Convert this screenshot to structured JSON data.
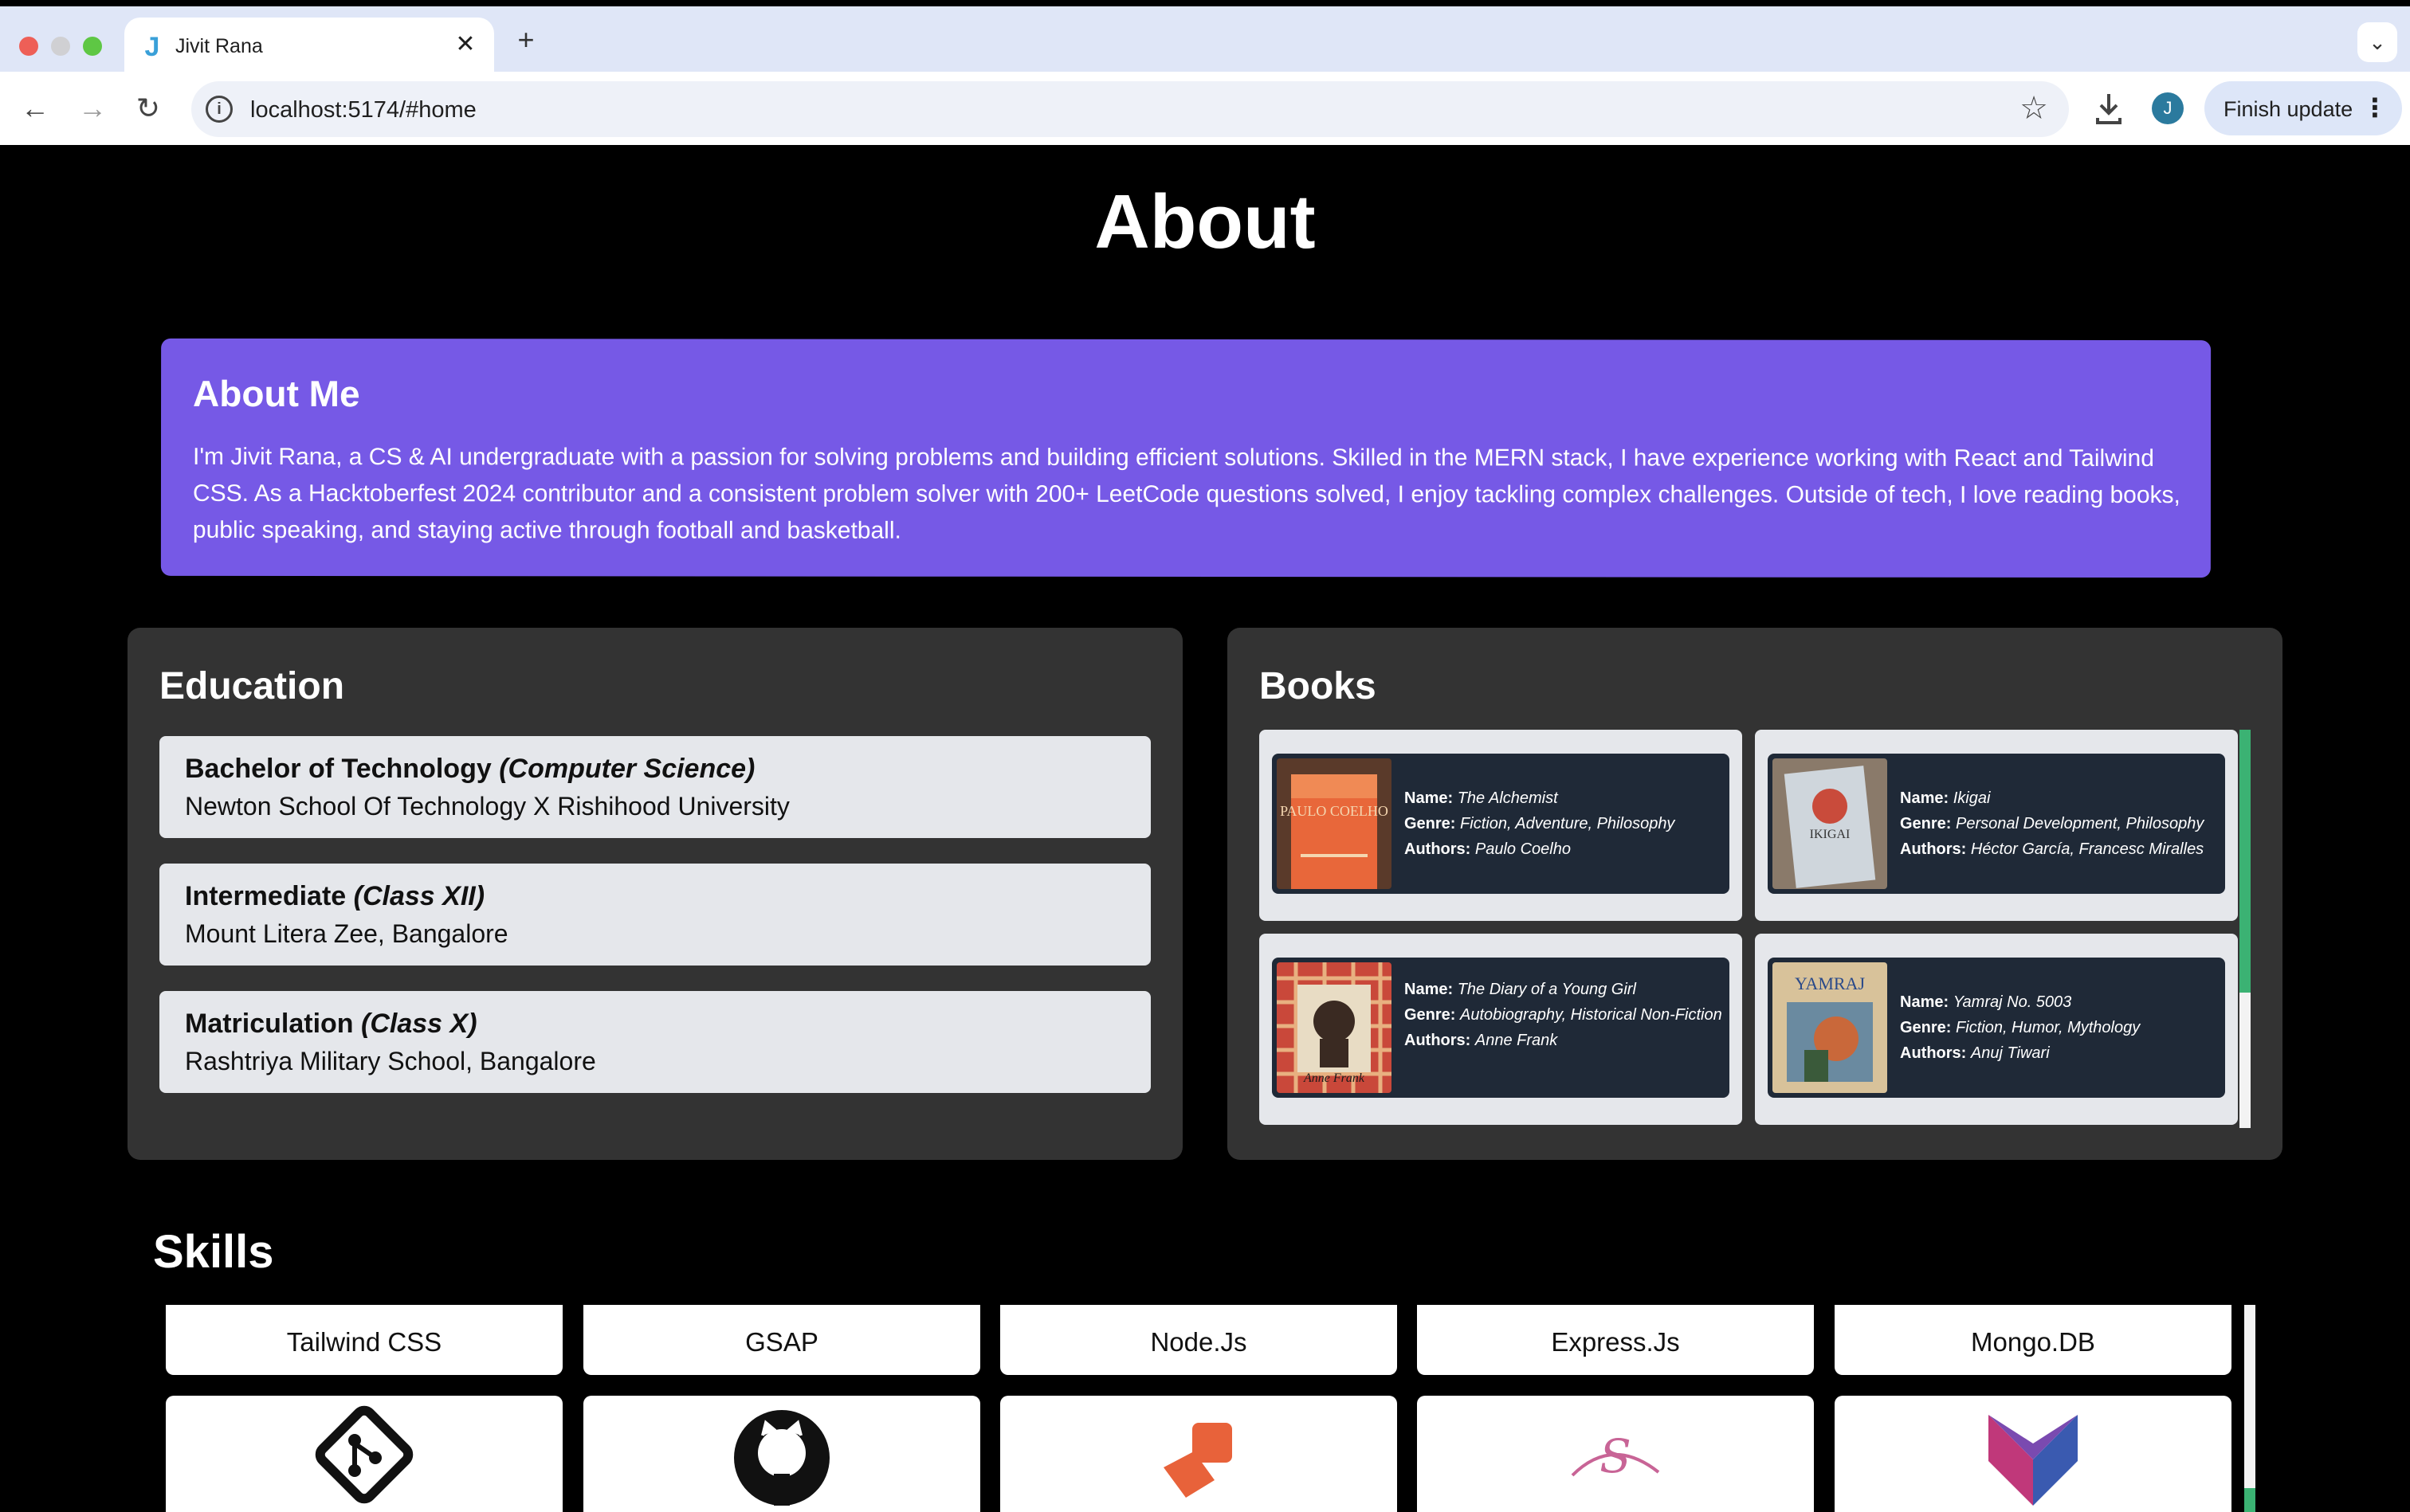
{
  "browser": {
    "tab_title": "Jivit Rana",
    "tab_favicon": "J",
    "url": "localhost:5174/#home",
    "profile_initial": "J",
    "finish_update_label": "Finish update"
  },
  "page": {
    "title": "About",
    "about": {
      "heading": "About Me",
      "text": "I'm Jivit Rana, a CS & AI undergraduate with a passion for solving problems and building efficient solutions. Skilled in the MERN stack, I have experience working with React and Tailwind CSS. As a Hacktoberfest 2024 contributor and a consistent problem solver with 200+ LeetCode questions solved, I enjoy tackling complex challenges. Outside of tech, I love reading books, public speaking, and staying active through football and basketball."
    },
    "education": {
      "heading": "Education",
      "items": [
        {
          "degree": "Bachelor of Technology",
          "field": "(Computer Science)",
          "institution": "Newton School Of Technology X Rishihood University"
        },
        {
          "degree": "Intermediate",
          "field": "(Class XII)",
          "institution": "Mount Litera Zee, Bangalore"
        },
        {
          "degree": "Matriculation",
          "field": "(Class X)",
          "institution": "Rashtriya Military School, Bangalore"
        }
      ]
    },
    "books": {
      "heading": "Books",
      "name_label": "Name:",
      "genre_label": "Genre:",
      "authors_label": "Authors:",
      "items": [
        {
          "name": "The Alchemist",
          "genre": "Fiction, Adventure, Philosophy",
          "authors": "Paulo Coelho",
          "cover_text": "PAULO COELHO"
        },
        {
          "name": "Ikigai",
          "genre": "Personal Development, Philosophy",
          "authors": "Héctor García, Francesc Miralles",
          "cover_text": "IKIGAI"
        },
        {
          "name": "The Diary of a Young Girl",
          "genre": "Autobiography, Historical Non-Fiction",
          "authors": "Anne Frank",
          "cover_text": "Anne Frank"
        },
        {
          "name": "Yamraj No. 5003",
          "genre": "Fiction, Humor, Mythology",
          "authors": "Anuj Tiwari",
          "cover_text": "YAMRAJ"
        }
      ]
    },
    "skills": {
      "heading": "Skills",
      "row1": [
        "Tailwind CSS",
        "GSAP",
        "Node.Js",
        "Express.Js",
        "Mongo.DB"
      ],
      "row2_icons": [
        "git-icon",
        "github-icon",
        "postman-icon",
        "sass-icon",
        "framer-motion-icon"
      ]
    }
  },
  "colors": {
    "about_bg": "#7659e6",
    "panel_bg": "#333333",
    "card_bg": "#e5e7eb",
    "book_inner_bg": "#1f2937",
    "scroll_thumb": "#3bb273"
  }
}
